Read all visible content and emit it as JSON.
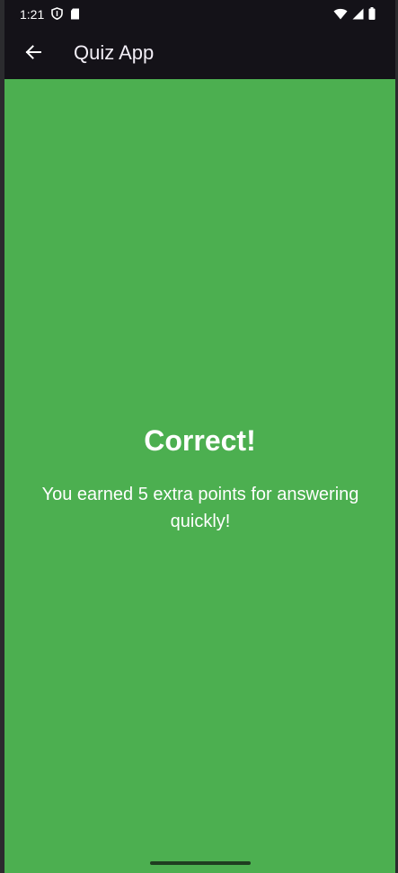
{
  "status_bar": {
    "time": "1:21",
    "left_icons": [
      "shield-icon",
      "sim-card-icon"
    ],
    "right_icons": [
      "wifi-icon",
      "signal-icon",
      "battery-icon"
    ]
  },
  "app_bar": {
    "back_icon": "arrow-left-icon",
    "title": "Quiz App"
  },
  "result": {
    "title": "Correct!",
    "message": "You earned 5 extra points for answering quickly!"
  },
  "colors": {
    "app_bar_background": "#141218",
    "content_background": "#4caf50",
    "text": "#ffffff"
  }
}
